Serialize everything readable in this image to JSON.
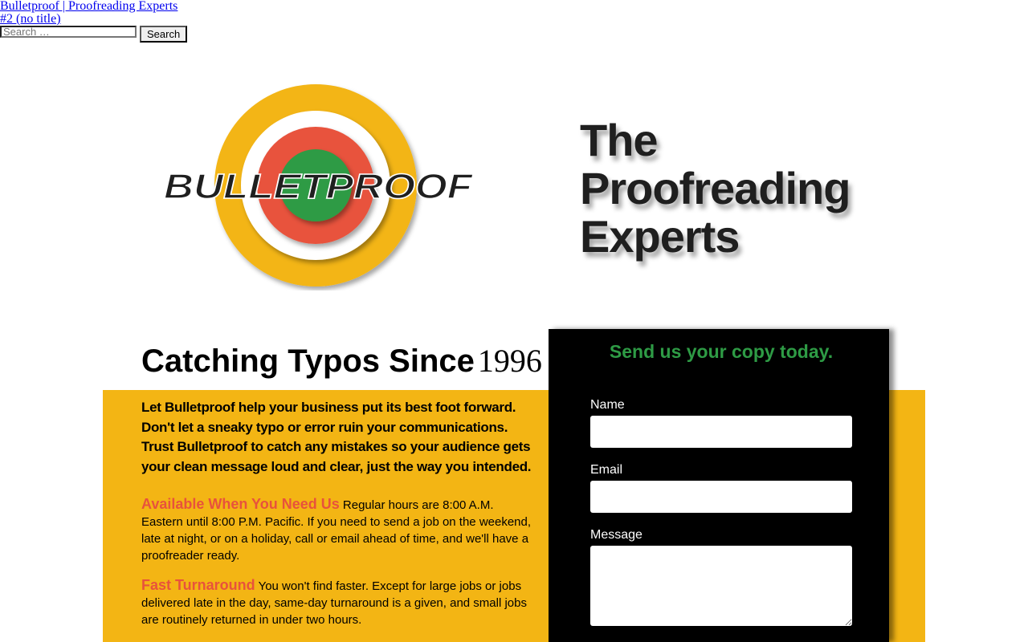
{
  "nav": {
    "site_link": "Bulletproof | Proofreading Experts",
    "page_link": "#2 (no title)"
  },
  "search": {
    "placeholder": "Search …",
    "button_label": "Search"
  },
  "logo": {
    "wordmark": "BULLETPROOF",
    "colors": {
      "outer_ring": "#f3b514",
      "white_ring": "#ffffff",
      "red_ring": "#e8523c",
      "center": "#2e9b45",
      "text": "#1f1f1f"
    }
  },
  "hero": {
    "lines": [
      "The",
      "Proofreading",
      "Experts"
    ]
  },
  "main": {
    "headline_part1": "Catching Typos Since",
    "headline_part2": "1996",
    "intro": "Let Bulletproof help your business put its best foot forward. Don't let a sneaky typo or error ruin your communications. Trust Bulletproof to catch any mistakes so your audience gets your clean message loud and clear, just the way you intended.",
    "features": [
      {
        "title": "Available When You Need Us",
        "text": "Regular hours are 8:00 A.M. Eastern until 8:00 P.M. Pacific. If you need to send a job on the weekend, late at night, or on a holiday, call or email ahead of time, and we'll have a proofreader ready."
      },
      {
        "title": "Fast Turnaround",
        "text": "You won't find faster. Except for large jobs or jobs delivered late in the day, same-day turnaround is a given, and small jobs are routinely returned in under two hours."
      }
    ]
  },
  "form": {
    "title": "Send us your copy today.",
    "name_label": "Name",
    "email_label": "Email",
    "message_label": "Message"
  },
  "colors": {
    "band": "#f3b514",
    "accent_red": "#e8523c",
    "accent_green": "#2e9b45",
    "panel": "#000000"
  }
}
